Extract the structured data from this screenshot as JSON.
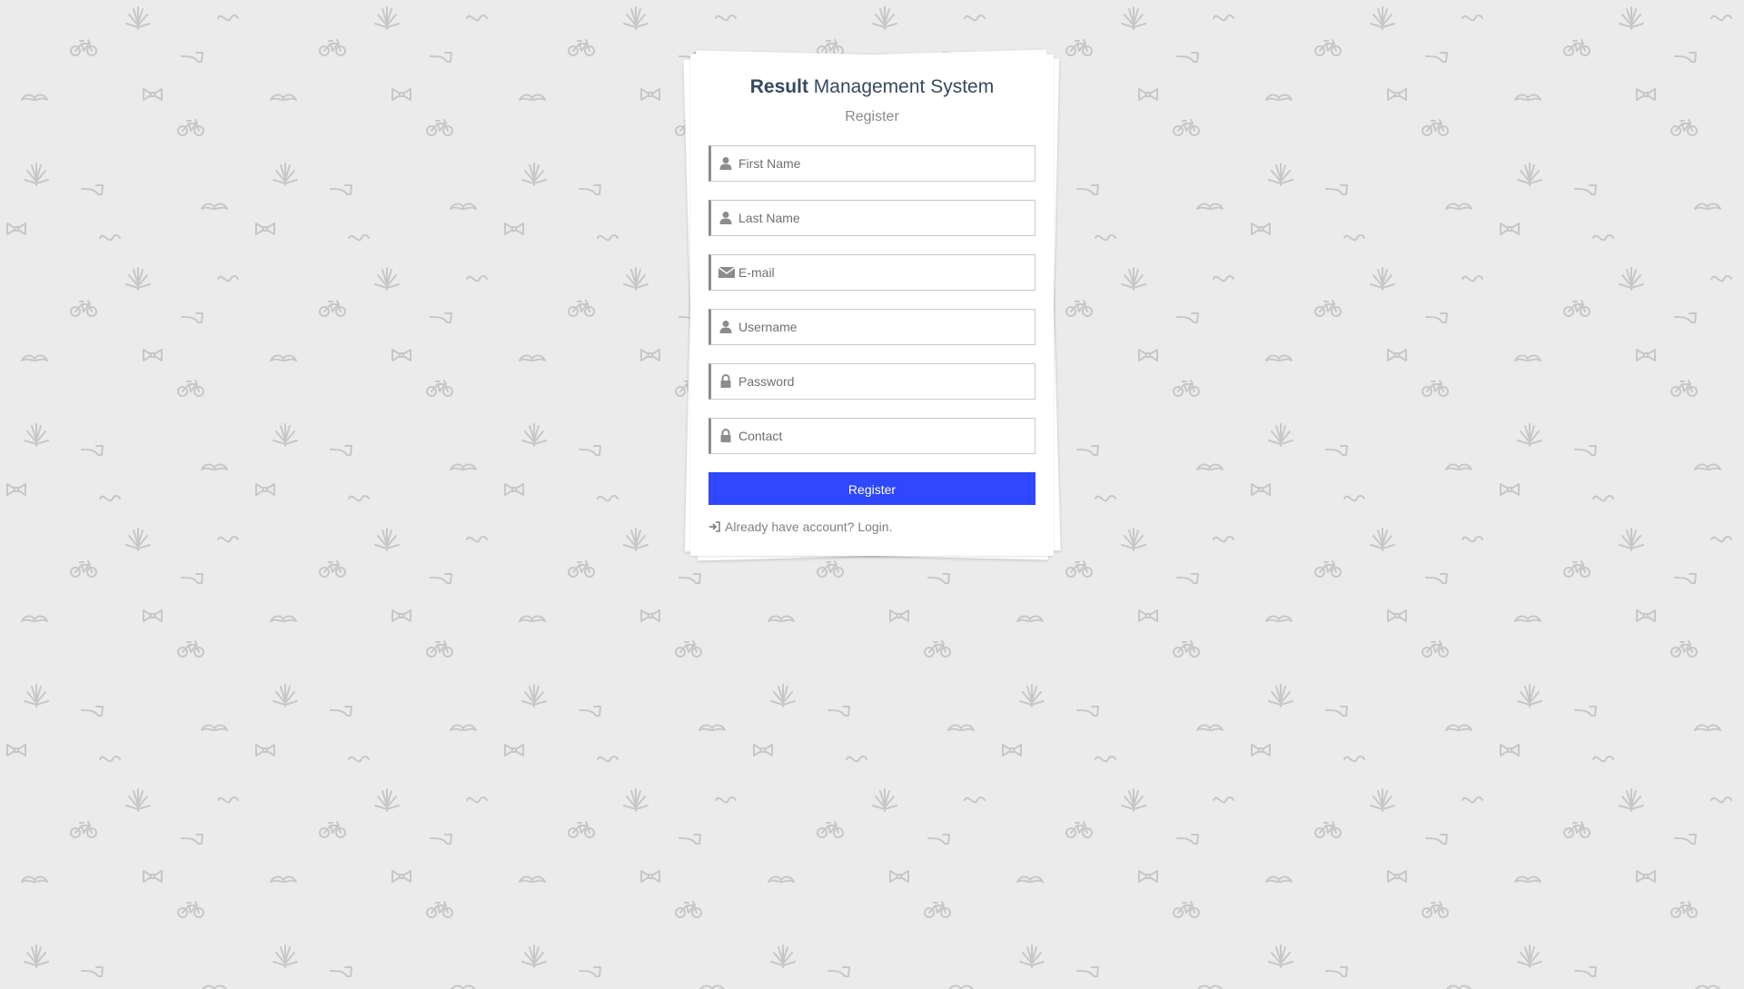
{
  "app": {
    "title_bold": "Result",
    "title_rest": " Management System",
    "subtitle": "Register"
  },
  "form": {
    "fields": [
      {
        "name": "first-name",
        "placeholder": "First Name",
        "value": "",
        "icon": "user-icon"
      },
      {
        "name": "last-name",
        "placeholder": "Last Name",
        "value": "",
        "icon": "user-icon"
      },
      {
        "name": "email",
        "placeholder": "E-mail",
        "value": "",
        "icon": "envelope-icon"
      },
      {
        "name": "username",
        "placeholder": "Username",
        "value": "",
        "icon": "user-icon"
      },
      {
        "name": "password",
        "placeholder": "Password",
        "value": "",
        "icon": "lock-icon"
      },
      {
        "name": "contact",
        "placeholder": "Contact",
        "value": "",
        "icon": "lock-icon"
      }
    ],
    "submit_label": "Register",
    "login_link_text": "Already have account? Login.",
    "login_link_icon": "sign-in-icon"
  },
  "colors": {
    "background": "#ebebeb",
    "pattern": "#c7c7c7",
    "card": "#ffffff",
    "primary_button": "#2e47ff",
    "title_text": "#34495e",
    "muted_text": "#808080",
    "field_accent_border": "#8c8c8c"
  },
  "background_pattern_icons": [
    "leaf-icon",
    "bicycle-icon",
    "bow-tie-icon",
    "mustache-icon",
    "pipe-icon"
  ]
}
